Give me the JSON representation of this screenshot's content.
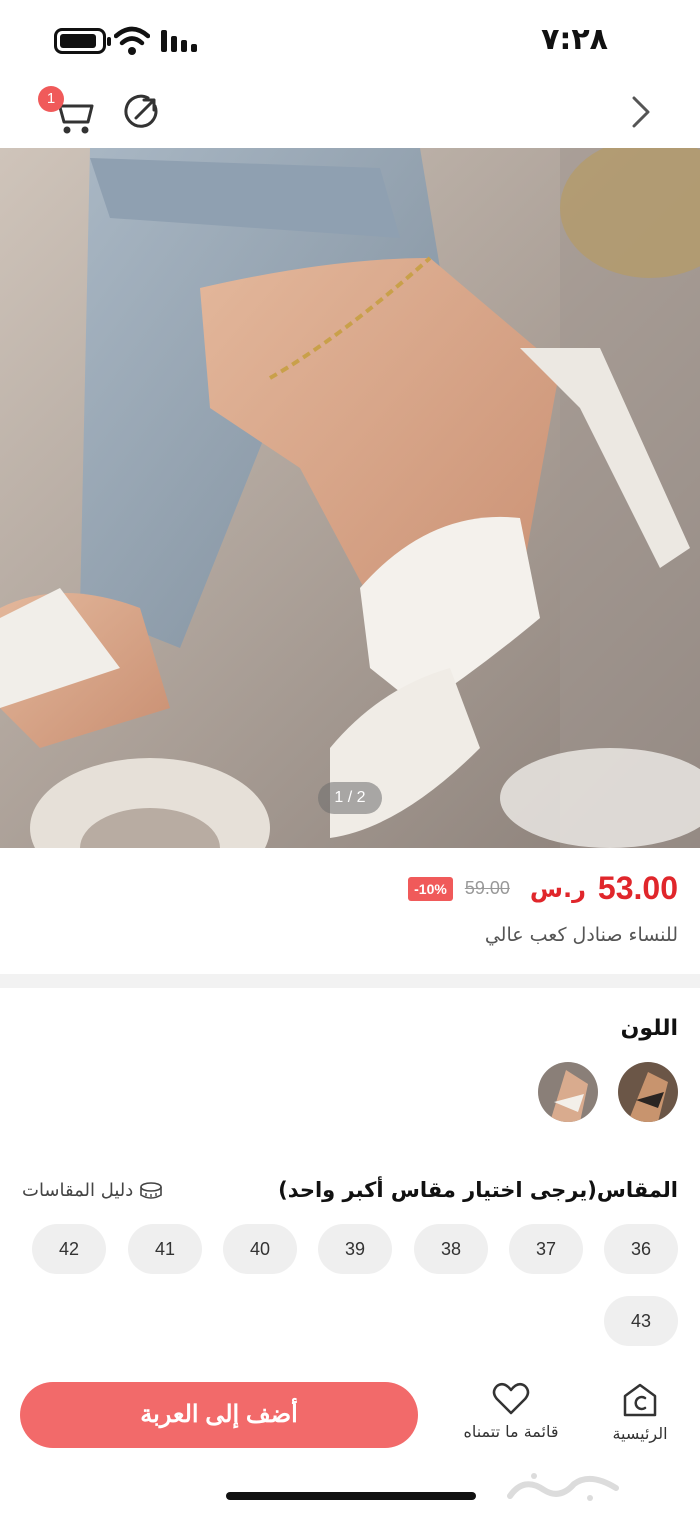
{
  "status_bar": {
    "time": "٧:٢٨"
  },
  "header": {
    "cart_count": "1"
  },
  "gallery": {
    "pager": "1 / 2"
  },
  "product": {
    "price": "53.00",
    "currency": "ر.س",
    "old_price": "59.00",
    "discount": "-10%",
    "title": "للنساء صنادل كعب عالي"
  },
  "color_section": {
    "label": "اللون"
  },
  "size_section": {
    "label": "المقاس(يرجى اختيار مقاس أكبر واحد)",
    "guide_label": "دليل المقاسات",
    "sizes": [
      "36",
      "37",
      "38",
      "39",
      "40",
      "41",
      "42",
      "43"
    ]
  },
  "bottom_nav": {
    "home_label": "الرئيسية",
    "wishlist_label": "قائمة ما تتمناه",
    "add_to_cart_label": "أضف إلى العربة"
  },
  "colors": {
    "accent": "#e0262b",
    "button": "#f26a6a",
    "badge": "#f05a5a"
  }
}
